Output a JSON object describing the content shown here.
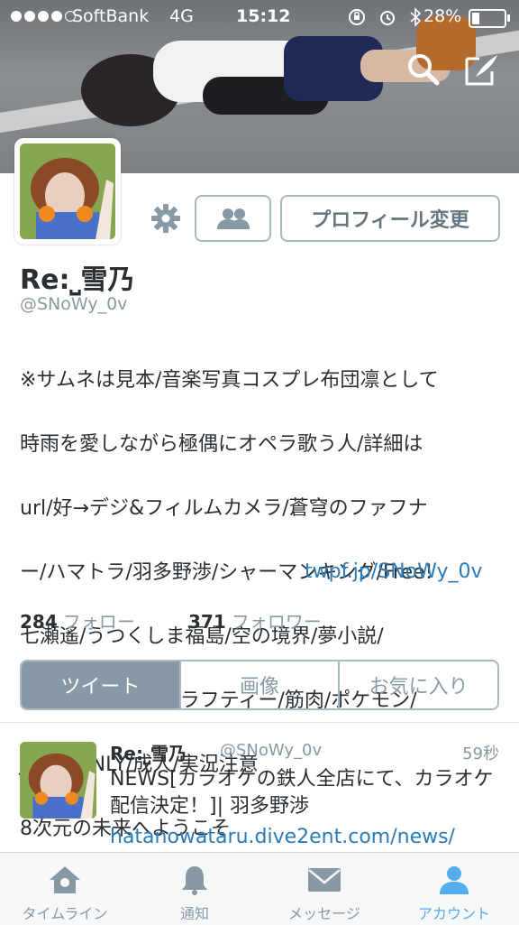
{
  "status_bar": {
    "carrier": "SoftBank",
    "network": "4G",
    "time": "15:12",
    "battery_percent_text": "28%",
    "battery_level": 0.28
  },
  "profile": {
    "display_name": "Re:⎵雪乃",
    "handle": "@SNoWy_0v",
    "edit_button_label": "プロフィール変更",
    "bio_lines": [
      "※サムネは見本/音楽写真コスプレ布団凛として",
      "時雨を愛しながら極偶にオペラ歌う人/詳細は",
      "url/好→デジ&フィルムカメラ/蒼穹のファフナ",
      "ー/ハマトラ/羽多野渉/シャーマンキング/Free!",
      "七瀬遙/うつくしま福島/空の境界/夢小説/",
      "UVER/ロットングラフティー/筋肉/ポケモン/",
      "JapanONLY/成人/実況注意",
      "8次元の未来へようこそ"
    ],
    "bio_link": "twpf.jp/SNoWy_0v",
    "following_count": "284",
    "following_label": "フォロー",
    "followers_count": "371",
    "followers_label": "フォロワー"
  },
  "segments": [
    {
      "label": "ツイート",
      "active": true
    },
    {
      "label": "画像",
      "active": false
    },
    {
      "label": "お気に入り",
      "active": false
    }
  ],
  "tweet": {
    "name": "Re:⎵雪乃",
    "handle": "@SNoWy_0v",
    "time": "59秒",
    "text": "NEWS[カラオケの鉄人全店にて、カラオケ配信決定！]| 羽多野渉",
    "link": "hatanowataru.dive2ent.com/news/"
  },
  "tabbar": [
    {
      "label": "タイムライン",
      "icon": "home-icon",
      "active": false
    },
    {
      "label": "通知",
      "icon": "bell-icon",
      "active": false
    },
    {
      "label": "メッセージ",
      "icon": "envelope-icon",
      "active": false
    },
    {
      "label": "アカウント",
      "icon": "person-icon",
      "active": true
    }
  ],
  "colors": {
    "accent": "#55acee",
    "link": "#2b7bb9",
    "muted": "#8899a6",
    "border": "#aab8c2"
  }
}
